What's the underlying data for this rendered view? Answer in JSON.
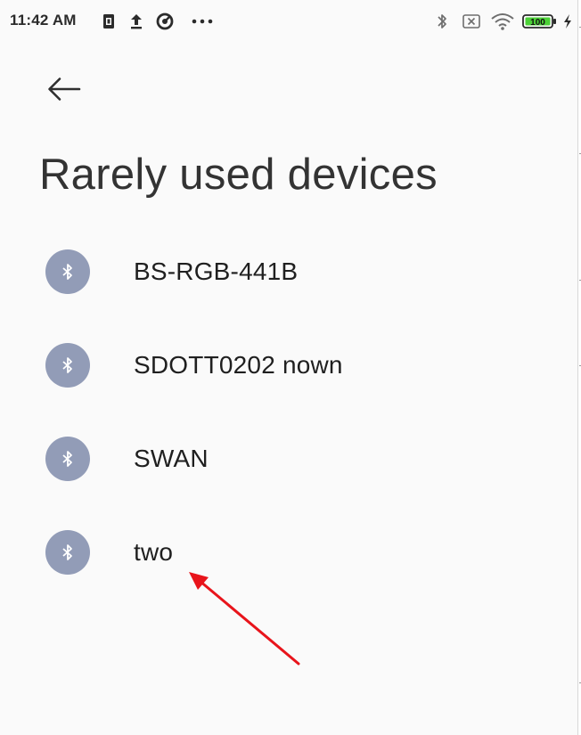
{
  "status_bar": {
    "time": "11:42 AM",
    "battery_level": "100",
    "left_icons": [
      "notification-app-icon",
      "upload-icon",
      "data-saver-icon",
      "more-dots-icon"
    ],
    "right_icons": [
      "bluetooth-icon",
      "no-sim-icon",
      "wifi-icon",
      "battery-icon",
      "charging-icon"
    ]
  },
  "header": {
    "back_icon": "arrow-left-icon",
    "title": "Rarely used devices"
  },
  "devices": [
    {
      "name": "BS-RGB-441B",
      "icon": "bluetooth-icon"
    },
    {
      "name": "SDOTT0202 nown",
      "icon": "bluetooth-icon"
    },
    {
      "name": "SWAN",
      "icon": "bluetooth-icon"
    },
    {
      "name": "two",
      "icon": "bluetooth-icon"
    }
  ],
  "colors": {
    "device_icon_bg": "#929cb7",
    "battery_fill": "#4cd137",
    "annotation_arrow": "#e8141b"
  }
}
